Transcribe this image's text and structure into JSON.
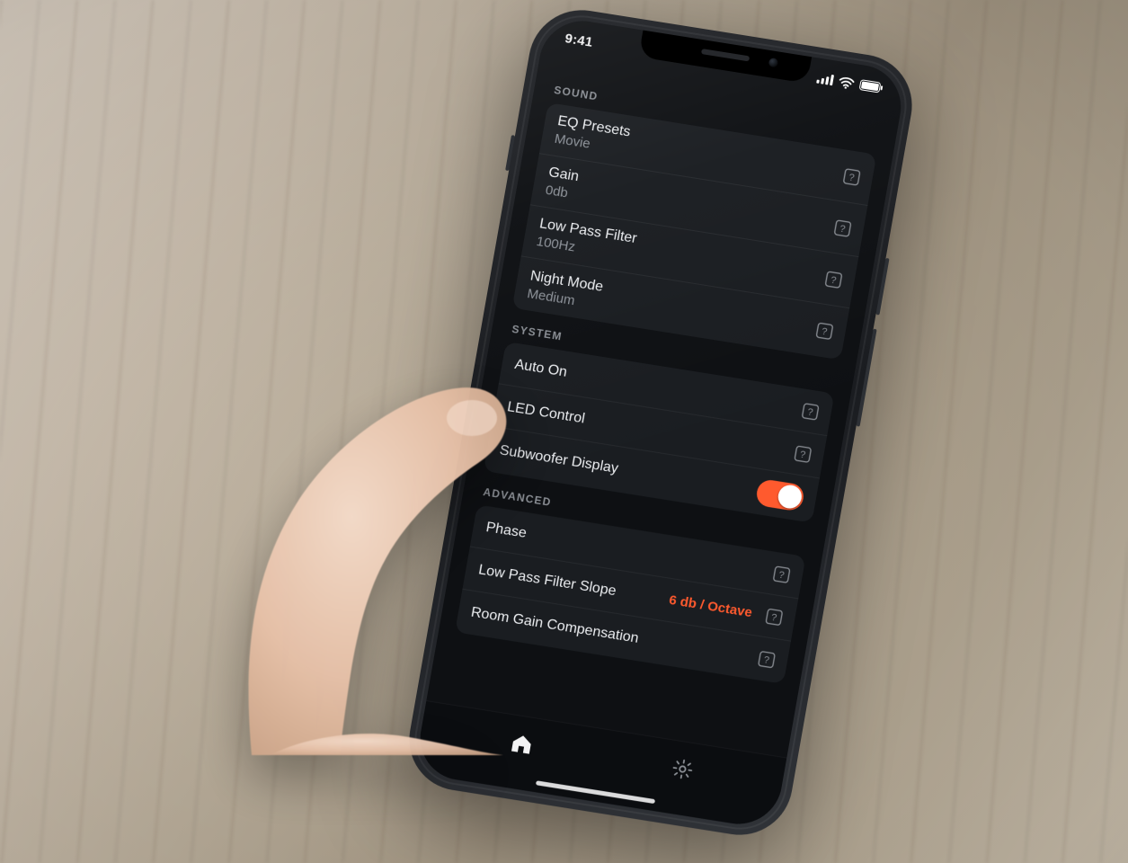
{
  "status": {
    "time": "9:41"
  },
  "sections": {
    "sound": {
      "title": "SOUND",
      "eq_presets": {
        "label": "EQ Presets",
        "value": "Movie"
      },
      "gain": {
        "label": "Gain",
        "value": "0db"
      },
      "lpf": {
        "label": "Low Pass Filter",
        "value": "100Hz"
      },
      "night": {
        "label": "Night Mode",
        "value": "Medium"
      }
    },
    "system": {
      "title": "SYSTEM",
      "auto_on": {
        "label": "Auto On"
      },
      "led": {
        "label": "LED Control"
      },
      "display": {
        "label": "Subwoofer Display"
      }
    },
    "advanced": {
      "title": "ADVANCED",
      "phase": {
        "label": "Phase"
      },
      "lpf_slope": {
        "label": "Low Pass Filter Slope"
      },
      "room_gain": {
        "label": "Room Gain Compensation",
        "value": "6 db / Octave"
      }
    }
  },
  "colors": {
    "accent": "#ff5a2e",
    "card": "#1a1d21",
    "bg": "#0e1013"
  }
}
